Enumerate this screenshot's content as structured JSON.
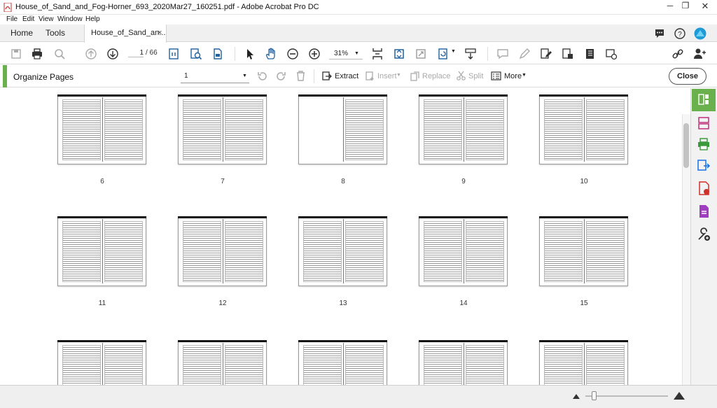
{
  "window": {
    "title": "House_of_Sand_and_Fog-Horner_693_2020Mar27_160251.pdf - Adobe Acrobat Pro DC"
  },
  "menu": {
    "file": "File",
    "edit": "Edit",
    "view": "View",
    "window": "Window",
    "help": "Help"
  },
  "tabs": {
    "home": "Home",
    "tools": "Tools",
    "document": "House_of_Sand_an...",
    "close_glyph": "×"
  },
  "toolbar": {
    "page_current": "1",
    "page_total": "/ 66",
    "zoom": "31%"
  },
  "organize": {
    "title": "Organize Pages",
    "page_select": "1",
    "extract": "Extract",
    "insert": "Insert",
    "replace": "Replace",
    "split": "Split",
    "more": "More",
    "close": "Close"
  },
  "pages": [
    {
      "n": "6"
    },
    {
      "n": "7"
    },
    {
      "n": "8"
    },
    {
      "n": "9"
    },
    {
      "n": "10"
    },
    {
      "n": "11"
    },
    {
      "n": "12"
    },
    {
      "n": "13"
    },
    {
      "n": "14"
    },
    {
      "n": "15"
    },
    {
      "n": ""
    },
    {
      "n": ""
    },
    {
      "n": ""
    },
    {
      "n": ""
    },
    {
      "n": ""
    }
  ],
  "colors": {
    "accent_green": "#6ab04c",
    "accent_blue": "#1473e6"
  }
}
